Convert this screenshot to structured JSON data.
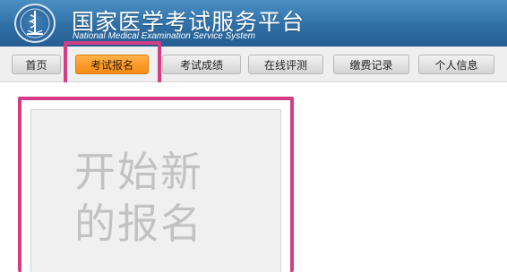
{
  "site": {
    "title_cn": "国家医学考试服务平台",
    "title_en": "National Medical Examination Service System"
  },
  "logo": {
    "icon": "medical-emblem-icon"
  },
  "nav": {
    "items": [
      {
        "label": "首页",
        "active": false
      },
      {
        "label": "考试报名",
        "active": true
      },
      {
        "label": "考试成绩",
        "active": false
      },
      {
        "label": "在线评测",
        "active": false
      },
      {
        "label": "缴费记录",
        "active": false
      },
      {
        "label": "个人信息",
        "active": false
      }
    ]
  },
  "main": {
    "new_registration": {
      "line1": "开始新",
      "line2": "的报名"
    }
  },
  "colors": {
    "header_blue": "#2f6fa6",
    "active_orange": "#f68a10",
    "highlight_pink": "#d43d86"
  }
}
